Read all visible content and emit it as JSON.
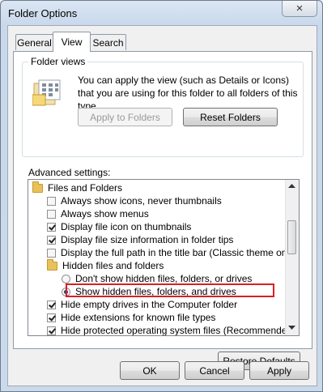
{
  "window": {
    "title": "Folder Options",
    "close_glyph": "×"
  },
  "tabs": [
    {
      "label": "General",
      "active": false
    },
    {
      "label": "View",
      "active": true
    },
    {
      "label": "Search",
      "active": false
    }
  ],
  "folder_views": {
    "group_label": "Folder views",
    "description": "You can apply the view (such as Details or Icons) that you are using for this folder to all folders of this type.",
    "apply_button": "Apply to Folders",
    "reset_button": "Reset Folders",
    "icon": "folder-views-icon"
  },
  "advanced": {
    "label": "Advanced settings:",
    "items": [
      {
        "type": "folder",
        "label": "Files and Folders",
        "checked": false
      },
      {
        "type": "checkbox",
        "label": "Always show icons, never thumbnails",
        "checked": false
      },
      {
        "type": "checkbox",
        "label": "Always show menus",
        "checked": false
      },
      {
        "type": "checkbox",
        "label": "Display file icon on thumbnails",
        "checked": true
      },
      {
        "type": "checkbox",
        "label": "Display file size information in folder tips",
        "checked": true
      },
      {
        "type": "checkbox",
        "label": "Display the full path in the title bar (Classic theme only)",
        "checked": false
      },
      {
        "type": "folder",
        "label": "Hidden files and folders",
        "checked": false
      },
      {
        "type": "radio",
        "label": "Don't show hidden files, folders, or drives",
        "checked": false
      },
      {
        "type": "radio",
        "label": "Show hidden files, folders, and drives",
        "checked": true
      },
      {
        "type": "checkbox",
        "label": "Hide empty drives in the Computer folder",
        "checked": true
      },
      {
        "type": "checkbox",
        "label": "Hide extensions for known file types",
        "checked": true
      },
      {
        "type": "checkbox",
        "label": "Hide protected operating system files (Recommended)",
        "checked": true
      }
    ],
    "restore_button": "Restore Defaults"
  },
  "footer": {
    "ok": "OK",
    "cancel": "Cancel",
    "apply": "Apply"
  },
  "colors": {
    "highlight": "#d81f26"
  }
}
